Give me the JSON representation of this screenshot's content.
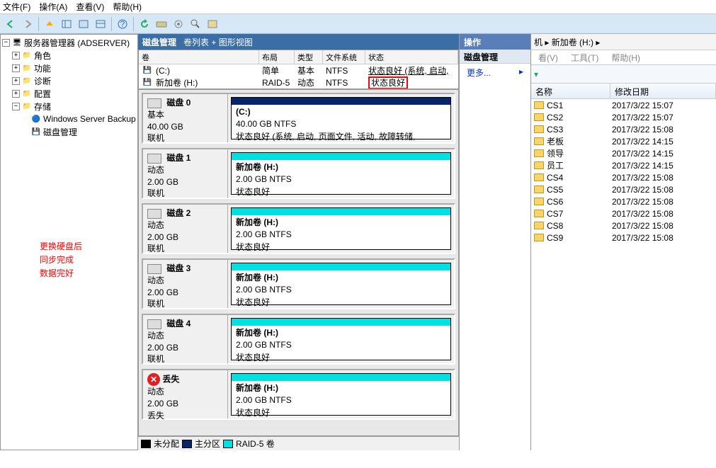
{
  "menu": {
    "file": "文件(F)",
    "action": "操作(A)",
    "view": "查看(V)",
    "help": "帮助(H)"
  },
  "tree": {
    "root": "服务器管理器 (ADSERVER)",
    "role": "角色",
    "feature": "功能",
    "diag": "诊断",
    "config": "配置",
    "storage": "存储",
    "wsb": "Windows Server Backup",
    "disk_mgmt": "磁盘管理"
  },
  "red_note": {
    "l1": "更换硬盘后",
    "l2": "同步完成",
    "l3": "数据完好"
  },
  "center": {
    "title": "磁盘管理",
    "subtitle": "卷列表 + 图形视图"
  },
  "vol_cols": {
    "vol": "卷",
    "layout": "布局",
    "type": "类型",
    "fs": "文件系统",
    "status": "状态"
  },
  "vol_rows": [
    {
      "name": "(C:)",
      "layout": "简单",
      "type": "基本",
      "fs": "NTFS",
      "status": "状态良好 (系统, 启动,"
    },
    {
      "name": "新加卷 (H:)",
      "layout": "RAID-5",
      "type": "动态",
      "fs": "NTFS",
      "status": "状态良好"
    }
  ],
  "disks": [
    {
      "name": "磁盘 0",
      "ln1": "基本",
      "ln2": "40.00 GB",
      "ln3": "联机",
      "bar": "navy",
      "v_title": "(C:)",
      "v_l2": "40.00 GB NTFS",
      "v_l3": "状态良好 (系统, 启动, 页面文件, 活动, 故障转储,"
    },
    {
      "name": "磁盘 1",
      "ln1": "动态",
      "ln2": "2.00 GB",
      "ln3": "联机",
      "bar": "cyan",
      "v_title": "新加卷 (H:)",
      "v_l2": "2.00 GB NTFS",
      "v_l3": "状态良好"
    },
    {
      "name": "磁盘 2",
      "ln1": "动态",
      "ln2": "2.00 GB",
      "ln3": "联机",
      "bar": "cyan",
      "v_title": "新加卷 (H:)",
      "v_l2": "2.00 GB NTFS",
      "v_l3": "状态良好"
    },
    {
      "name": "磁盘 3",
      "ln1": "动态",
      "ln2": "2.00 GB",
      "ln3": "联机",
      "bar": "cyan",
      "v_title": "新加卷 (H:)",
      "v_l2": "2.00 GB NTFS",
      "v_l3": "状态良好"
    },
    {
      "name": "磁盘 4",
      "ln1": "动态",
      "ln2": "2.00 GB",
      "ln3": "联机",
      "bar": "cyan",
      "v_title": "新加卷 (H:)",
      "v_l2": "2.00 GB NTFS",
      "v_l3": "状态良好"
    },
    {
      "name": "丢失",
      "ln1": "动态",
      "ln2": "2.00 GB",
      "ln3": "丢失",
      "bar": "cyan",
      "err": true,
      "v_title": "新加卷 (H:)",
      "v_l2": "2.00 GB NTFS",
      "v_l3": "状态良好"
    }
  ],
  "legend": {
    "unalloc": "未分配",
    "primary": "主分区",
    "raid5": "RAID-5 卷"
  },
  "right": {
    "title": "操作",
    "sub": "磁盘管理",
    "more": "更多..."
  },
  "far": {
    "bread": "机 ▸ 新加卷 (H:) ▸",
    "menu_view": "看(V)",
    "menu_tool": "工具(T)",
    "menu_help": "帮助(H)",
    "col_name": "名称",
    "col_date": "修改日期",
    "items": [
      {
        "name": "CS1",
        "date": "2017/3/22 15:07"
      },
      {
        "name": "CS2",
        "date": "2017/3/22 15:07"
      },
      {
        "name": "CS3",
        "date": "2017/3/22 15:08"
      },
      {
        "name": "老板",
        "date": "2017/3/22 14:15"
      },
      {
        "name": "领导",
        "date": "2017/3/22 14:15"
      },
      {
        "name": "员工",
        "date": "2017/3/22 14:15"
      },
      {
        "name": "CS4",
        "date": "2017/3/22 15:08"
      },
      {
        "name": "CS5",
        "date": "2017/3/22 15:08"
      },
      {
        "name": "CS6",
        "date": "2017/3/22 15:08"
      },
      {
        "name": "CS7",
        "date": "2017/3/22 15:08"
      },
      {
        "name": "CS8",
        "date": "2017/3/22 15:08"
      },
      {
        "name": "CS9",
        "date": "2017/3/22 15:08"
      }
    ]
  }
}
